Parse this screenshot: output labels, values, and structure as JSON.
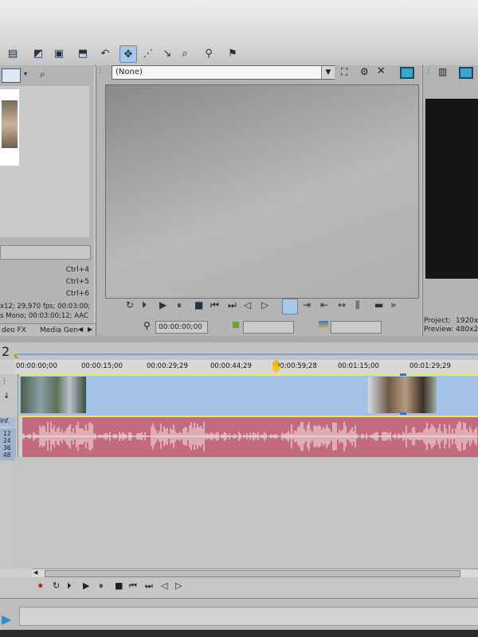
{
  "media_panel": {
    "shortcuts": [
      "Ctrl+4",
      "Ctrl+5",
      "Ctrl+6"
    ],
    "info_line1": "x12; 29,970 fps; 00:03:00;",
    "info_line2": "s Mono; 00:03:00;12; AAC",
    "tabs": [
      "deo FX",
      "Media Gen"
    ]
  },
  "trimmer": {
    "preset_value": "(None)",
    "timecode": "00:00:00;00"
  },
  "video_preview": {
    "project_label": "Project:",
    "project_value": "1920x",
    "preview_label": "Preview:",
    "preview_value": "480x2"
  },
  "timeline": {
    "track_number": "2",
    "level_label": "Inf.",
    "db_labels": [
      "12",
      "24",
      "36",
      "48"
    ],
    "ruler_ticks": [
      "00:00:00;00",
      "00:00:15;00",
      "00:00:29;29",
      "00:00:44;29",
      "00:00:59;28",
      "00:01:15;00",
      "00:01:29;29"
    ]
  },
  "icons": [
    "loop-icon",
    "play-from-start-icon",
    "play-icon",
    "pause-icon",
    "stop-icon",
    "previous-frame-icon",
    "next-frame-icon",
    "go-start-icon",
    "go-end-icon",
    "record-icon",
    "hand-cursor-icon"
  ],
  "colors": {
    "video_track": "#a3c3e6",
    "audio_track": "#c36b7e",
    "track_border": "#e8e86a",
    "selected_tool": "#aac7e6"
  }
}
